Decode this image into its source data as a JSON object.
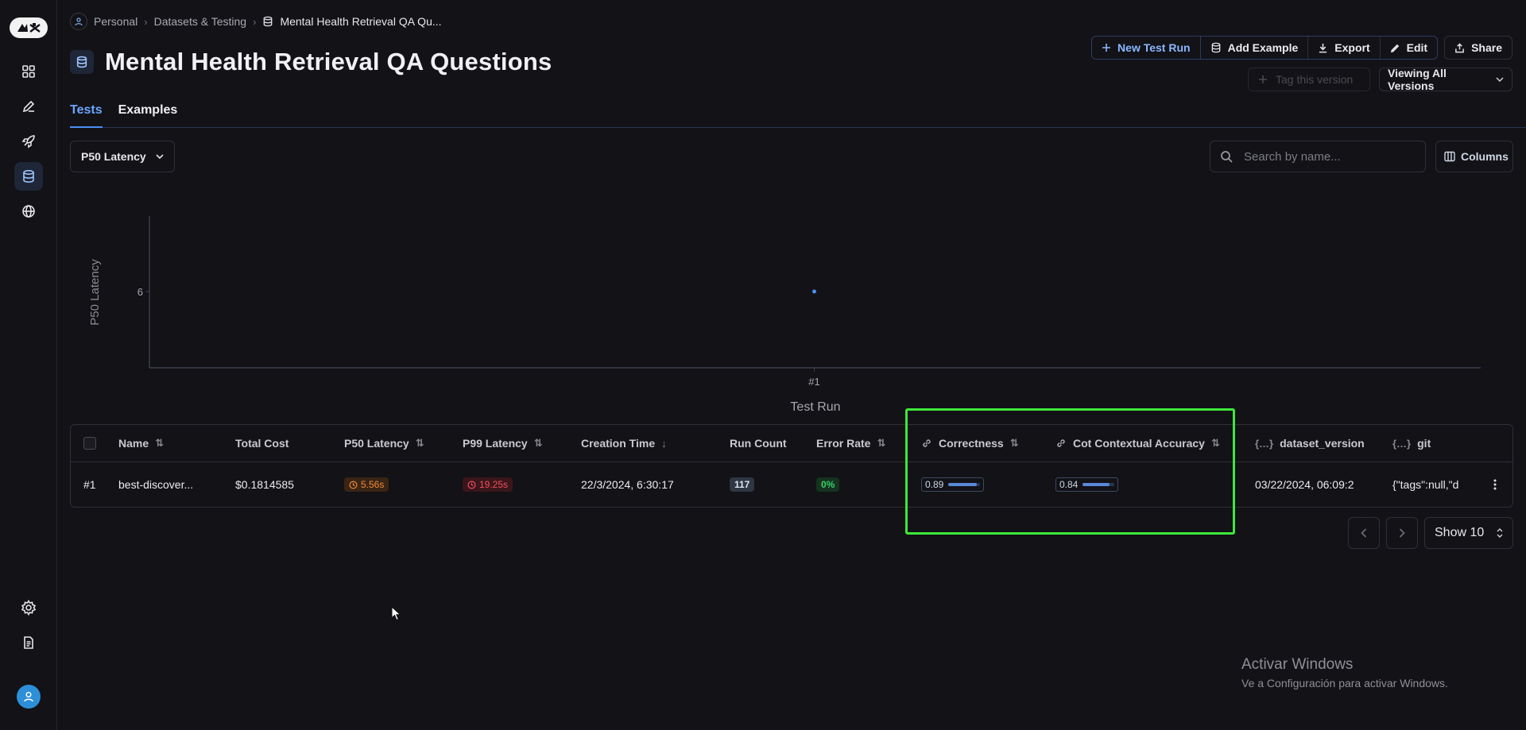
{
  "breadcrumbs": [
    "Personal",
    "Datasets & Testing",
    "Mental Health Retrieval QA Qu..."
  ],
  "page_title": "Mental Health Retrieval QA Questions",
  "actions": {
    "new_test_run": "New Test Run",
    "add_example": "Add Example",
    "export": "Export",
    "edit": "Edit",
    "share": "Share",
    "tag_version": "Tag this version",
    "viewing_versions": "Viewing All Versions"
  },
  "tabs": [
    "Tests",
    "Examples"
  ],
  "metric_select": "P50 Latency",
  "search": {
    "placeholder": "Search by name..."
  },
  "columns_label": "Columns",
  "chart_data": {
    "type": "scatter",
    "xlabel": "Test Run",
    "ylabel": "P50 Latency",
    "categories": [
      "#1"
    ],
    "y_ticks": [
      6
    ],
    "series": [
      {
        "x": [
          "#1"
        ],
        "values": [
          6
        ]
      }
    ]
  },
  "table": {
    "columns": [
      "Name",
      "Total Cost",
      "P50 Latency",
      "P99 Latency",
      "Creation Time",
      "Run Count",
      "Error Rate",
      "Correctness",
      "Cot Contextual Accuracy",
      "dataset_version",
      "git"
    ],
    "rows": [
      {
        "index": "#1",
        "name": "best-discover...",
        "total_cost": "$0.1814585",
        "p50_latency": "5.56s",
        "p99_latency": "19.25s",
        "creation_time": "22/3/2024, 6:30:17",
        "run_count": "117",
        "error_rate": "0%",
        "correctness": "0.89",
        "correctness_value": 0.89,
        "cot_accuracy": "0.84",
        "cot_accuracy_value": 0.84,
        "dataset_version": "03/22/2024, 06:09:2",
        "git": "{\"tags\":null,\"d"
      }
    ]
  },
  "pagination": {
    "show": "Show 10"
  },
  "watermark": {
    "title": "Activar Windows",
    "subtitle": "Ve a Configuración para activar Windows."
  },
  "colors": {
    "background": "#121217",
    "accent": "#4d8ff5",
    "highlight": "#3ee83a"
  }
}
